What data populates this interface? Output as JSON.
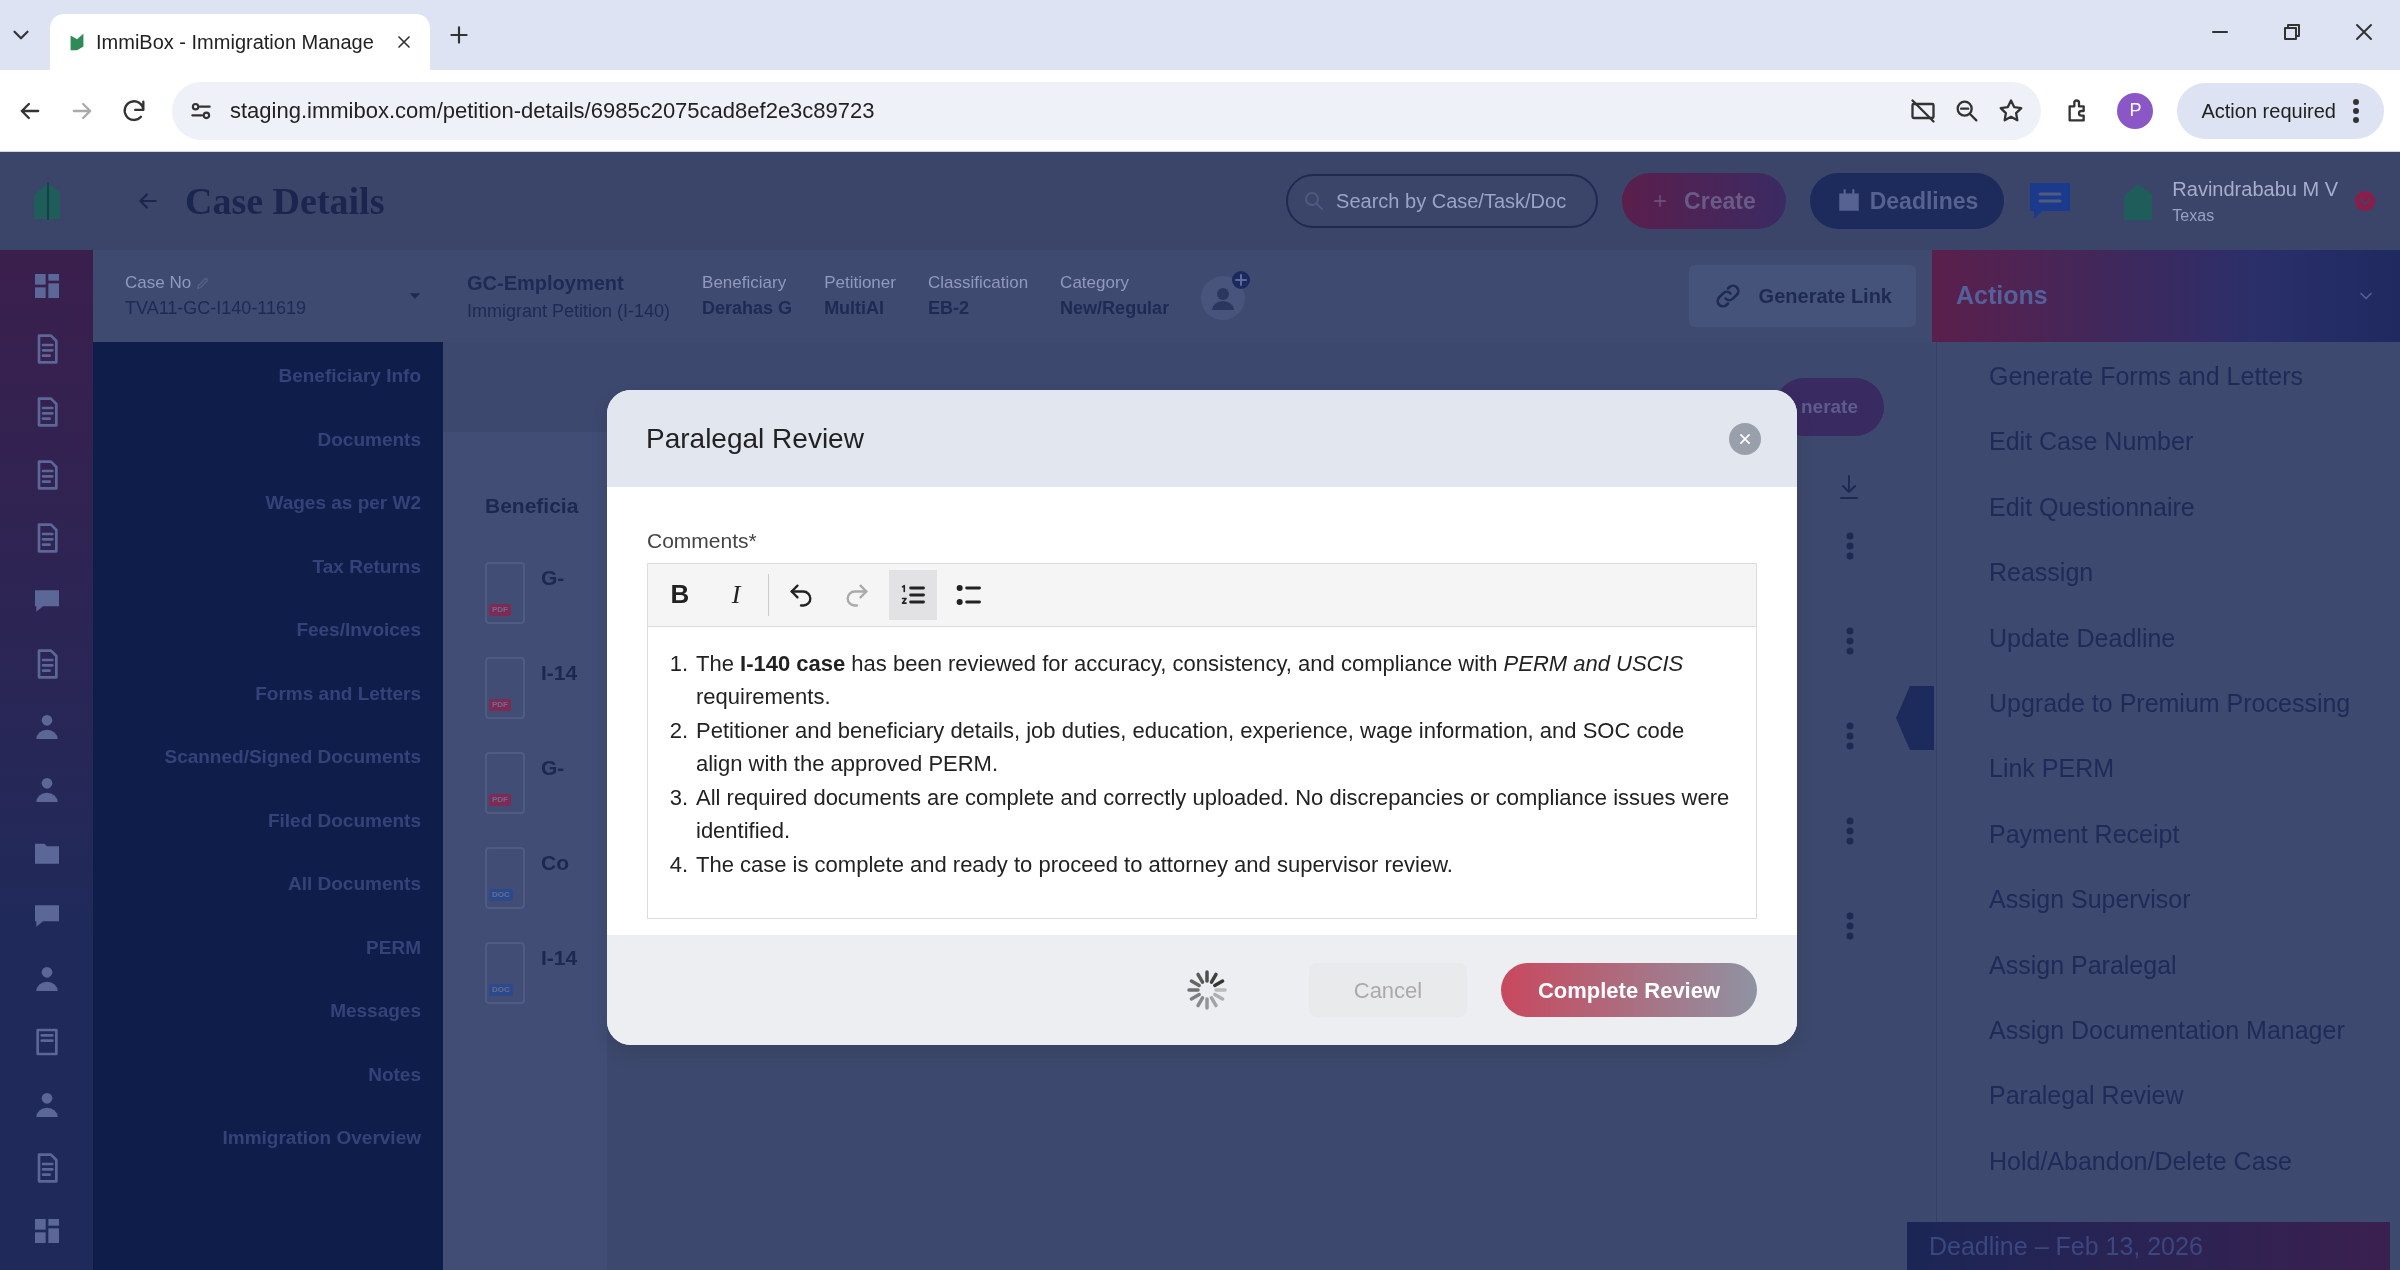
{
  "browser": {
    "tab_title": "ImmiBox - Immigration Manage",
    "url": "staging.immibox.com/petition-details/6985c2075cad8ef2e3c89723",
    "profile_initial": "P",
    "action_button": "Action required"
  },
  "header": {
    "title": "Case Details",
    "search": {
      "placeholder": "Search by Case/Task/Doc"
    },
    "create_button": "Create",
    "deadlines_button": "Deadlines",
    "user": {
      "name": "Ravindrababu M V",
      "location": "Texas"
    }
  },
  "case_bar": {
    "case_no_label": "Case No",
    "case_no": "TVA11-GC-I140-11619",
    "case_type": "GC-Employment",
    "case_subtype": "Immigrant Petition (I-140)",
    "fields": [
      {
        "label": "Beneficiary",
        "value": "Derahas G"
      },
      {
        "label": "Petitioner",
        "value": "MultiAI"
      },
      {
        "label": "Classification",
        "value": "EB-2"
      },
      {
        "label": "Category",
        "value": "New/Regular"
      }
    ],
    "generate_link_button": "Generate Link"
  },
  "sidebar": {
    "items": [
      "Beneficiary Info",
      "Documents",
      "Wages as per W2",
      "Tax Returns",
      "Fees/Invoices",
      "Forms and Letters",
      "Scanned/Signed Documents",
      "Filed Documents",
      "All Documents",
      "PERM",
      "Messages",
      "Notes",
      "Immigration Overview"
    ]
  },
  "main": {
    "section_title": "Beneficia",
    "generate_button": "nerate",
    "documents": [
      {
        "name": "G-",
        "file_type": "PDF"
      },
      {
        "name": "I-14",
        "file_type": "PDF"
      },
      {
        "name": "G-",
        "file_type": "PDF"
      },
      {
        "name": "Co",
        "file_type": "DOC"
      },
      {
        "name": "I-14",
        "file_type": "DOC"
      }
    ]
  },
  "actions": {
    "title": "Actions",
    "items": [
      "Generate Forms and Letters",
      "Edit Case Number",
      "Edit Questionnaire",
      "Reassign",
      "Update Deadline",
      "Upgrade to Premium Processing",
      "Link PERM",
      "Payment Receipt",
      "Assign Supervisor",
      "Assign Paralegal",
      "Assign Documentation Manager",
      "Paralegal Review",
      "Hold/Abandon/Delete Case"
    ],
    "deadline": "Deadline – Feb 13, 2026"
  },
  "modal": {
    "title": "Paralegal Review",
    "comments_label": "Comments*",
    "toolbar": [
      {
        "kind": "bold",
        "glyph": "B",
        "active": false,
        "disabled": false
      },
      {
        "kind": "italic",
        "glyph": "I",
        "active": false,
        "disabled": false
      },
      {
        "kind": "undo",
        "active": false,
        "disabled": false
      },
      {
        "kind": "redo",
        "active": false,
        "disabled": true
      },
      {
        "kind": "ordered-list",
        "active": true,
        "disabled": false
      },
      {
        "kind": "bullet-list",
        "active": false,
        "disabled": false
      }
    ],
    "comments": [
      {
        "marker": "1.",
        "text": "The **I-140 case** has been reviewed for accuracy, consistency, and compliance with *PERM and USCIS* requirements."
      },
      {
        "marker": "2.",
        "text": "Petitioner and beneficiary details, job duties, education, experience, wage information, and SOC code align with the approved PERM."
      },
      {
        "marker": "3.",
        "text": "All required documents are complete and correctly uploaded. No discrepancies or compliance issues were identified."
      },
      {
        "marker": "4.",
        "text": "The case is complete and ready to proceed to attorney and supervisor review."
      }
    ],
    "loading": true,
    "buttons": [
      {
        "kind": "cancel",
        "label": "Cancel",
        "disabled": true
      },
      {
        "kind": "primary",
        "label": "Complete Review",
        "disabled": true
      }
    ]
  }
}
